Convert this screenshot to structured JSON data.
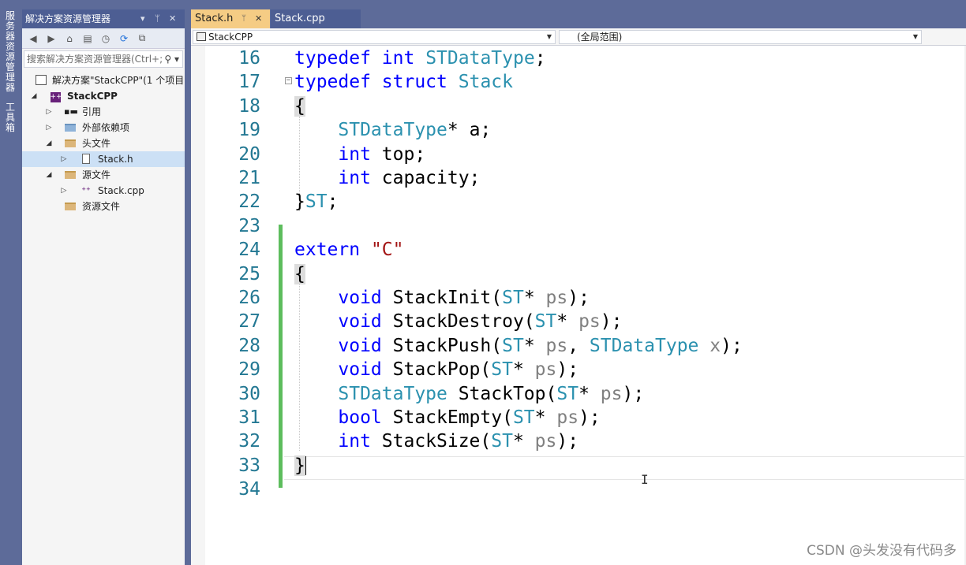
{
  "vertical_tabs": [
    "服务器资源管理器",
    "工具箱"
  ],
  "solution_explorer": {
    "title": "解决方案资源管理器",
    "title_controls": [
      "▾",
      "ᛘ",
      "✕"
    ],
    "search_placeholder": "搜索解决方案资源管理器(Ctrl+;)",
    "tree": [
      {
        "label": "解决方案\"StackCPP\"(1 个项目)",
        "level": 0,
        "arrow": "",
        "icon": "solution-icon"
      },
      {
        "label": "StackCPP",
        "level": 0,
        "arrow": "◢",
        "icon": "project-icon",
        "bold": true
      },
      {
        "label": "引用",
        "level": 1,
        "arrow": "▷",
        "icon": "references-icon"
      },
      {
        "label": "外部依赖项",
        "level": 1,
        "arrow": "▷",
        "icon": "external-deps-icon"
      },
      {
        "label": "头文件",
        "level": 1,
        "arrow": "◢",
        "icon": "folder-icon"
      },
      {
        "label": "Stack.h",
        "level": 2,
        "arrow": "▷",
        "icon": "header-file-icon",
        "selected": true
      },
      {
        "label": "源文件",
        "level": 1,
        "arrow": "◢",
        "icon": "folder-icon"
      },
      {
        "label": "Stack.cpp",
        "level": 2,
        "arrow": "▷",
        "icon": "cpp-file-icon"
      },
      {
        "label": "资源文件",
        "level": 1,
        "arrow": "",
        "icon": "folder-icon"
      }
    ]
  },
  "tabs": [
    {
      "label": "Stack.h",
      "active": true,
      "pin": "ᛘ",
      "close": "✕"
    },
    {
      "label": "Stack.cpp",
      "active": false
    }
  ],
  "navbar": {
    "project": "StackCPP",
    "scope": "(全局范围)"
  },
  "code_lines": [
    {
      "n": "16",
      "code": "typedef int STDataType;"
    },
    {
      "n": "17",
      "code": "typedef struct Stack"
    },
    {
      "n": "18",
      "code": "{"
    },
    {
      "n": "19",
      "code": "    STDataType* a;"
    },
    {
      "n": "20",
      "code": "    int top;"
    },
    {
      "n": "21",
      "code": "    int capacity;"
    },
    {
      "n": "22",
      "code": "}ST;"
    },
    {
      "n": "23",
      "code": ""
    },
    {
      "n": "24",
      "code": "extern \"C\""
    },
    {
      "n": "25",
      "code": "{"
    },
    {
      "n": "26",
      "code": "    void StackInit(ST* ps);"
    },
    {
      "n": "27",
      "code": "    void StackDestroy(ST* ps);"
    },
    {
      "n": "28",
      "code": "    void StackPush(ST* ps, STDataType x);"
    },
    {
      "n": "29",
      "code": "    void StackPop(ST* ps);"
    },
    {
      "n": "30",
      "code": "    STDataType StackTop(ST* ps);"
    },
    {
      "n": "31",
      "code": "    bool StackEmpty(ST* ps);"
    },
    {
      "n": "32",
      "code": "    int StackSize(ST* ps);"
    },
    {
      "n": "33",
      "code": "}"
    },
    {
      "n": "34",
      "code": ""
    }
  ],
  "watermark": "CSDN @头发没有代码多",
  "colors": {
    "keyword": "#0000ff",
    "type": "#2b91af",
    "string": "#a31515",
    "param": "#808080",
    "line_number": "#237893",
    "active_tab": "#f5cc84",
    "chrome": "#5d6b99",
    "change_bar": "#5dbd5d"
  }
}
